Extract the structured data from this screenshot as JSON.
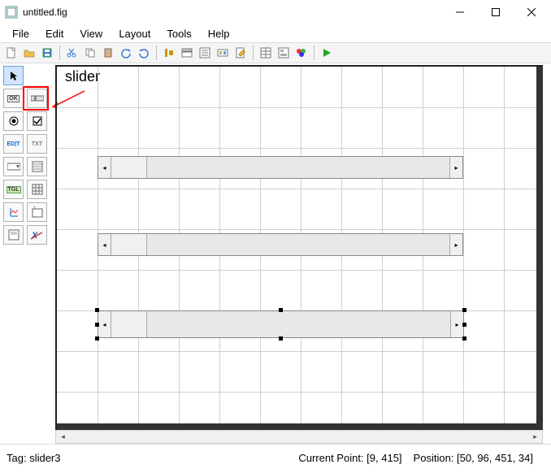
{
  "window": {
    "title": "untitled.fig"
  },
  "menu": {
    "file": "File",
    "edit": "Edit",
    "view": "View",
    "layout": "Layout",
    "tools": "Tools",
    "help": "Help"
  },
  "annotation": {
    "label": "slider"
  },
  "status": {
    "tag_label": "Tag: ",
    "tag_value": "slider3",
    "current_point_label": "Current Point:  ",
    "current_point_value": "[9, 415]",
    "position_label": "Position: ",
    "position_value": "[50, 96, 451, 34]"
  },
  "palette": {
    "tooltips": [
      "select",
      "pushbutton",
      "slider",
      "radio",
      "checkbox",
      "edit",
      "text",
      "popup",
      "listbox",
      "toggle",
      "table",
      "axes",
      "txt2",
      "panel",
      "buttongroup"
    ]
  }
}
